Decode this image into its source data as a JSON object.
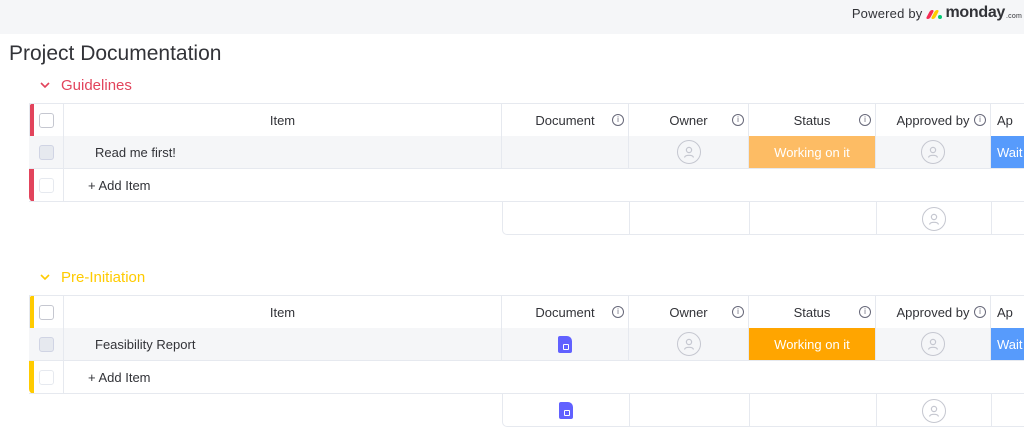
{
  "branding": {
    "powered_by": "Powered by",
    "logo_word": "monday",
    "logo_suffix": ".com"
  },
  "page": {
    "title": "Project Documentation"
  },
  "columns": {
    "item": "Item",
    "document": "Document",
    "owner": "Owner",
    "status": "Status",
    "approved_by": "Approved by",
    "next": "Ap"
  },
  "groups": [
    {
      "name": "Guidelines",
      "color": "#e2445c",
      "rows": [
        {
          "item": "Read me first!",
          "has_document": false,
          "status": "Working on it",
          "status_color": "#fdbc64",
          "next_value": "Wait"
        }
      ],
      "add_item_label": "+ Add Item",
      "summary_has_document": false
    },
    {
      "name": "Pre-Initiation",
      "color": "#ffcb00",
      "rows": [
        {
          "item": "Feasibility Report",
          "has_document": true,
          "status": "Working on it",
          "status_color": "#ffa500",
          "next_value": "Wait"
        }
      ],
      "add_item_label": "+ Add Item",
      "summary_has_document": true
    }
  ],
  "colors": {
    "next_column_status": "#579bfc",
    "doc_icon": "#6161ff"
  }
}
